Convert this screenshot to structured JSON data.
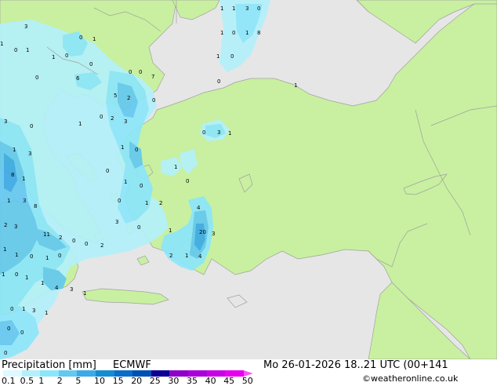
{
  "footer": {
    "product": "Precipitation [mm]",
    "model": "ECMWF",
    "valid_time": "Mo 26-01-2026 18..21 UTC (00+141",
    "credit": "©weatheronline.co.uk"
  },
  "legend": {
    "labels": [
      "0.1",
      "0.5",
      "1",
      "2",
      "5",
      "10",
      "15",
      "20",
      "25",
      "30",
      "35",
      "40",
      "45",
      "50"
    ],
    "colors": [
      "#dcfaff",
      "#b4f0fa",
      "#8ce6fa",
      "#64c8f0",
      "#3caae6",
      "#148cd2",
      "#0a6ec8",
      "#0050b4",
      "#0a0096",
      "#8c00c8",
      "#aa00dc",
      "#c800e6",
      "#e600f0",
      "#ff50ff"
    ]
  },
  "map": {
    "land_color": "#c8f0a0",
    "sea_color": "#e6e6e6",
    "values": [
      "1",
      "1",
      "3",
      "0",
      "1",
      "0",
      "1",
      "8",
      "0",
      "1",
      "3",
      "1",
      "0",
      "1",
      "1",
      "0",
      "6",
      "0",
      "0",
      "0",
      "0",
      "7",
      "5",
      "2",
      "0",
      "3",
      "0",
      "2",
      "1",
      "3",
      "1",
      "0",
      "3",
      "8",
      "1",
      "0",
      "1",
      "0",
      "0",
      "1",
      "0",
      "1",
      "2",
      "0",
      "8",
      "1",
      "3",
      "1",
      "3",
      "0",
      "20",
      "3",
      "1",
      "2",
      "1",
      "4",
      "4",
      "11",
      "2",
      "0",
      "0",
      "2",
      "2",
      "3",
      "1",
      "1",
      "0",
      "1",
      "0",
      "1",
      "0",
      "1",
      "1",
      "4",
      "3",
      "1",
      "0",
      "3",
      "1",
      "1",
      "0",
      "0",
      "1",
      "0",
      "1",
      "3",
      "1",
      "0",
      "0",
      "0"
    ]
  }
}
